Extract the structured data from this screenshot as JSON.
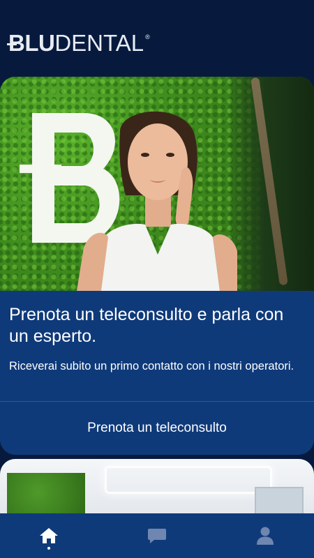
{
  "brand": {
    "logo_bold": "BLU",
    "logo_regular": "DENTAL",
    "logo_registered": "®"
  },
  "promo_card": {
    "title": "Prenota un teleconsulto e parla con un esperto.",
    "description": "Riceverai subito un primo contatto con i nostri operatori.",
    "cta_label": "Prenota un teleconsulto"
  },
  "tabbar": {
    "items": [
      {
        "icon": "home-icon",
        "active": true
      },
      {
        "icon": "chat-icon",
        "active": false
      },
      {
        "icon": "profile-icon",
        "active": false
      }
    ]
  },
  "colors": {
    "background": "#071a3e",
    "card": "#0f3a7a",
    "text": "#ffffff"
  }
}
